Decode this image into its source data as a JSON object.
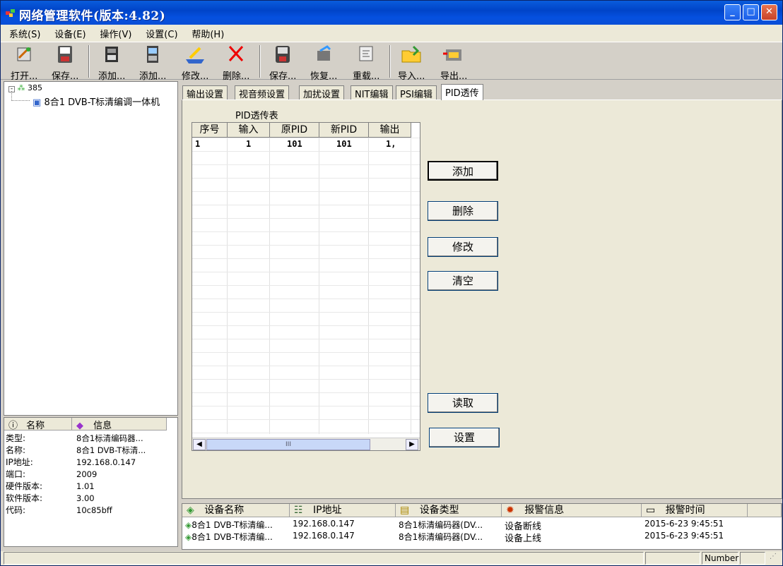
{
  "window": {
    "title": "网络管理软件(版本:4.82)"
  },
  "menu": [
    "系统(S)",
    "设备(E)",
    "操作(V)",
    "设置(C)",
    "帮助(H)"
  ],
  "toolbar": [
    "打开...",
    "保存...",
    "添加...",
    "添加...",
    "修改...",
    "删除...",
    "保存...",
    "恢复...",
    "重载...",
    "导入...",
    "导出..."
  ],
  "tree": {
    "root": "385",
    "child": "8合1 DVB-T标清编调一体机"
  },
  "info": {
    "headers": [
      "名称",
      "信息"
    ],
    "rows": [
      {
        "k": "类型:",
        "v": "8合1标清编码器..."
      },
      {
        "k": "名称:",
        "v": "8合1 DVB-T标清..."
      },
      {
        "k": "IP地址:",
        "v": "192.168.0.147"
      },
      {
        "k": "端口:",
        "v": "2009"
      },
      {
        "k": "硬件版本:",
        "v": "1.01"
      },
      {
        "k": "软件版本:",
        "v": "3.00"
      },
      {
        "k": "代码:",
        "v": "10c85bff"
      }
    ]
  },
  "tabs": [
    "输出设置",
    "视音频设置",
    "加扰设置",
    "NIT编辑",
    "PSI编辑",
    "PID透传"
  ],
  "pid": {
    "title": "PID透传表",
    "columns": [
      "序号",
      "输入",
      "原PID",
      "新PID",
      "输出"
    ],
    "rows": [
      [
        "1",
        "1",
        "101",
        "101",
        "1,"
      ]
    ],
    "scroll_mark": "III"
  },
  "buttons": {
    "add": "添加",
    "delete": "删除",
    "modify": "修改",
    "clear": "清空",
    "read": "读取",
    "set": "设置"
  },
  "alarm": {
    "columns": [
      "设备名称",
      "IP地址",
      "设备类型",
      "报警信息",
      "报警时间"
    ],
    "rows": [
      [
        "8合1 DVB-T标清编...",
        "192.168.0.147",
        "8合1标清编码器(DV...",
        "设备断线",
        "2015-6-23 9:45:51"
      ],
      [
        "8合1 DVB-T标清编...",
        "192.168.0.147",
        "8合1标清编码器(DV...",
        "设备上线",
        "2015-6-23 9:45:51"
      ]
    ]
  },
  "status": {
    "number": "Number"
  }
}
